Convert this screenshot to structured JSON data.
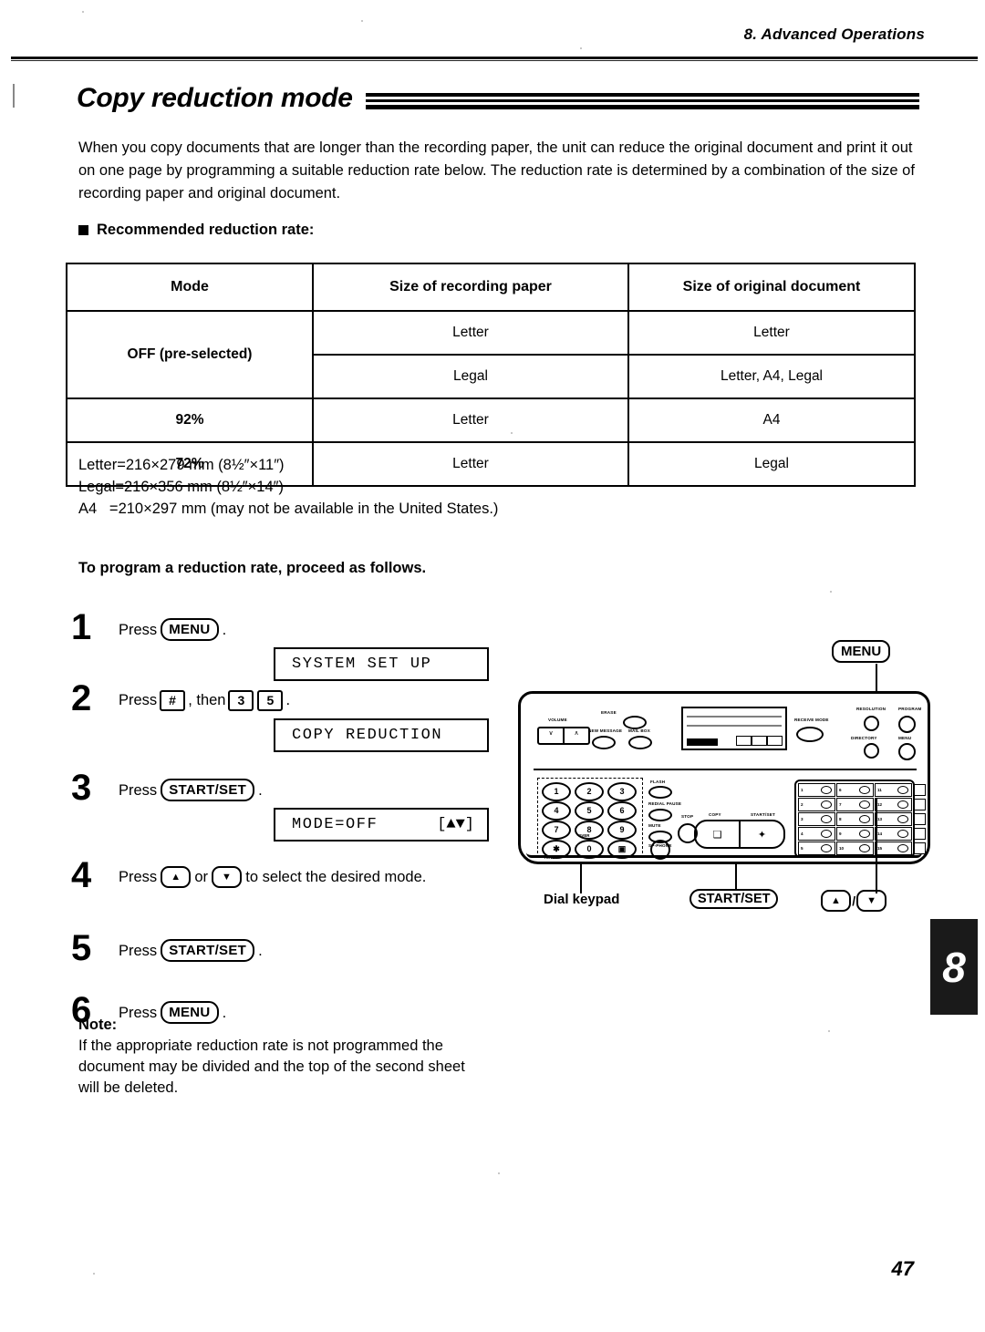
{
  "header": {
    "chapter_label": "8.  Advanced Operations"
  },
  "title": "Copy reduction mode",
  "intro": "When you copy documents that are longer than the recording paper, the unit can reduce the original document and print it out on one page by programming a suitable reduction rate below. The reduction rate is determined by a combination of the size of recording paper and original document.",
  "bullet_heading": "Recommended reduction rate:",
  "table": {
    "columns": [
      "Mode",
      "Size of recording paper",
      "Size of original document"
    ],
    "rows": [
      {
        "mode": "OFF (pre-selected)",
        "paper": "Letter",
        "original": "Letter"
      },
      {
        "mode": "",
        "paper": "Legal",
        "original": "Letter, A4, Legal"
      },
      {
        "mode": "92%",
        "paper": "Letter",
        "original": "A4"
      },
      {
        "mode": "72%",
        "paper": "Letter",
        "original": "Legal"
      }
    ]
  },
  "sizes": "Letter=216×279 mm (8½″×11″)\nLegal=216×356 mm (8½″×14″)\nA4   =210×297 mm (may not be available in the United States.)",
  "procedure_heading": "To program a reduction rate, proceed as follows.",
  "steps": [
    {
      "num": "1",
      "pre": "Press",
      "key": "MENU",
      "post": ".",
      "display": "SYSTEM SET UP",
      "display_right": ""
    },
    {
      "num": "2",
      "pre": "Press",
      "key": "#",
      "mid": ", then",
      "key2": "3",
      "key3": "5",
      "post": ".",
      "display": "COPY REDUCTION",
      "display_right": ""
    },
    {
      "num": "3",
      "pre": "Press",
      "key": "START/SET",
      "post": ".",
      "display": "MODE=OFF",
      "display_right": "[▲▼]"
    },
    {
      "num": "4",
      "pre": "Press",
      "key": "▲",
      "mid": "or",
      "key2": "▼",
      "post": "to select the desired mode."
    },
    {
      "num": "5",
      "pre": "Press",
      "key": "START/SET",
      "post": "."
    },
    {
      "num": "6",
      "pre": "Press",
      "key": "MENU",
      "post": "."
    }
  ],
  "note": {
    "label": "Note:",
    "text": "If the appropriate reduction rate is not programmed the document may be divided and the top of the second sheet will be deleted."
  },
  "illustration": {
    "menu_callout": "MENU",
    "dial_keypad_label": "Dial keypad",
    "start_set_label": "START/SET",
    "up_arrow": "▲",
    "down_arrow": "▼",
    "separator": "/",
    "panel_labels": {
      "volume": "VOLUME",
      "resolution": "RESOLUTION",
      "receive_mode": "RECEIVE MODE",
      "erase": "ERASE",
      "new_message": "NEW MESSAGE",
      "mail_box": "MAIL BOX",
      "flash": "FLASH",
      "redial_pause": "REDIAL PAUSE",
      "mute": "MUTE",
      "sp_phone": "SP-PHONE",
      "stop": "STOP",
      "copy": "COPY",
      "start_set": "START/SET",
      "tone": "TONE",
      "over": "OVER",
      "menu": "MENU",
      "directory": "DIRECTORY",
      "program": "PROGRAM"
    },
    "keypad_keys": [
      "1",
      "2",
      "3",
      "4",
      "5",
      "6",
      "7",
      "8",
      "9",
      "✱",
      "0",
      "▣"
    ],
    "station_numbers": [
      "1",
      "2",
      "3",
      "4",
      "5",
      "6",
      "7",
      "8",
      "9",
      "10",
      "11",
      "12",
      "13",
      "14",
      "15"
    ]
  },
  "chapter_tab": "8",
  "page_number": "47"
}
